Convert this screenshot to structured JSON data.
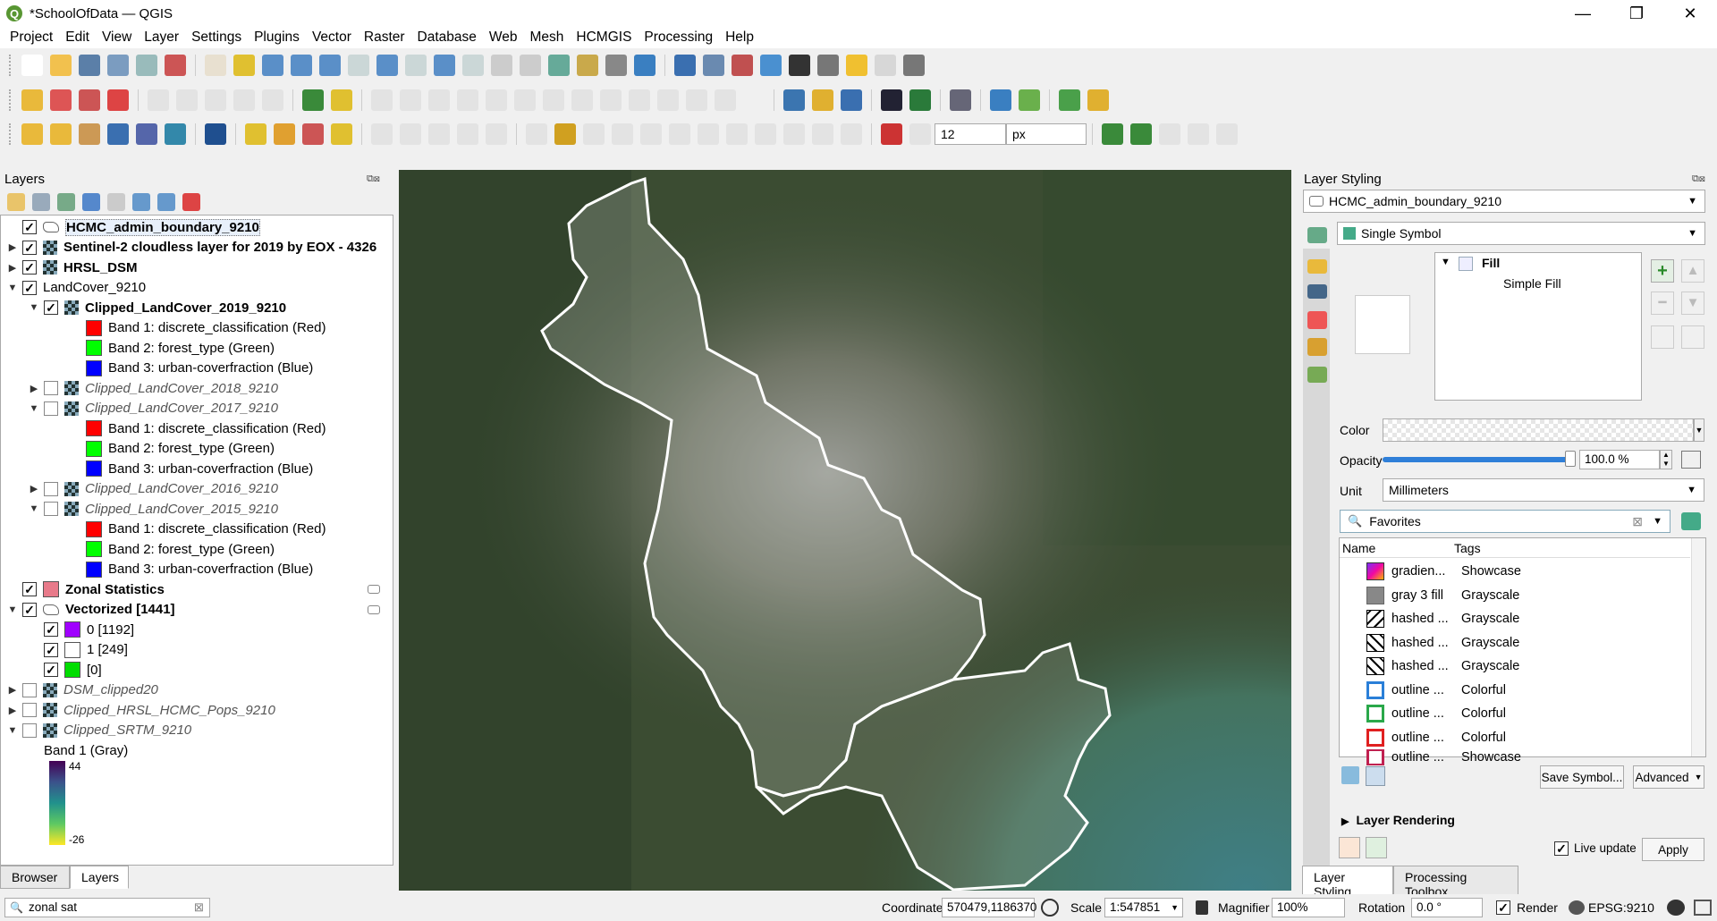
{
  "window": {
    "title": "*SchoolOfData — QGIS",
    "minimize": "—",
    "restore": "❐",
    "close": "✕"
  },
  "menu": [
    "Project",
    "Edit",
    "View",
    "Layer",
    "Settings",
    "Plugins",
    "Vector",
    "Raster",
    "Database",
    "Web",
    "Mesh",
    "HCMGIS",
    "Processing",
    "Help"
  ],
  "toolbar3": {
    "size_value": "12",
    "unit": "px"
  },
  "layers_panel": {
    "title": "Layers",
    "items": [
      {
        "label": "HCMC_admin_boundary_9210",
        "checked": true
      },
      {
        "label": "Sentinel-2 cloudless layer for 2019 by EOX - 4326",
        "checked": true
      },
      {
        "label": "HRSL_DSM",
        "checked": true
      },
      {
        "label": "LandCover_9210",
        "checked": true
      },
      {
        "label": "Clipped_LandCover_2019_9210",
        "checked": true
      },
      {
        "label": "Band 1: discrete_classification (Red)"
      },
      {
        "label": "Band 2: forest_type (Green)"
      },
      {
        "label": "Band 3: urban-coverfraction (Blue)"
      },
      {
        "label": "Clipped_LandCover_2018_9210",
        "checked": false
      },
      {
        "label": "Clipped_LandCover_2017_9210",
        "checked": false
      },
      {
        "label": "Band 1: discrete_classification (Red)"
      },
      {
        "label": "Band 2: forest_type (Green)"
      },
      {
        "label": "Band 3: urban-coverfraction (Blue)"
      },
      {
        "label": "Clipped_LandCover_2016_9210",
        "checked": false
      },
      {
        "label": "Clipped_LandCover_2015_9210",
        "checked": false
      },
      {
        "label": "Band 1: discrete_classification (Red)"
      },
      {
        "label": "Band 2: forest_type (Green)"
      },
      {
        "label": "Band 3: urban-coverfraction (Blue)"
      },
      {
        "label": "Zonal Statistics",
        "checked": true
      },
      {
        "label": "Vectorized [1441]",
        "checked": true
      },
      {
        "label": "0 [1192]",
        "checked": true
      },
      {
        "label": "1 [249]",
        "checked": true
      },
      {
        "label": "[0]",
        "checked": true
      },
      {
        "label": "DSM_clipped20",
        "checked": false
      },
      {
        "label": "Clipped_HRSL_HCMC_Pops_9210",
        "checked": false
      },
      {
        "label": "Clipped_SRTM_9210",
        "checked": false
      },
      {
        "label": "Band 1 (Gray)"
      }
    ],
    "ramp_max": "44",
    "ramp_min": "-26",
    "tab_browser": "Browser",
    "tab_layers": "Layers"
  },
  "search": {
    "value": "zonal sat"
  },
  "styling": {
    "title": "Layer Styling",
    "layer": "HCMC_admin_boundary_9210",
    "renderer": "Single Symbol",
    "symbol_tree": {
      "fill": "Fill",
      "simple_fill": "Simple Fill"
    },
    "color_label": "Color",
    "opacity_label": "Opacity",
    "opacity_value": "100.0 %",
    "opacity_level": 1.0,
    "unit_label": "Unit",
    "unit_value": "Millimeters",
    "favorites": "Favorites",
    "col_name": "Name",
    "col_tags": "Tags",
    "symbols": [
      {
        "name": "gradien...",
        "tag": "Showcase"
      },
      {
        "name": "gray 3 fill",
        "tag": "Grayscale"
      },
      {
        "name": "hashed ...",
        "tag": "Grayscale"
      },
      {
        "name": "hashed ...",
        "tag": "Grayscale"
      },
      {
        "name": "hashed ...",
        "tag": "Grayscale"
      },
      {
        "name": "outline ...",
        "tag": "Colorful"
      },
      {
        "name": "outline ...",
        "tag": "Colorful"
      },
      {
        "name": "outline ...",
        "tag": "Colorful"
      },
      {
        "name": "outline ...",
        "tag": "Showcase"
      }
    ],
    "save_symbol": "Save Symbol...",
    "advanced": "Advanced",
    "layer_rendering": "Layer Rendering",
    "live_update": "Live update",
    "apply": "Apply",
    "tab_styling": "Layer Styling",
    "tab_toolbox": "Processing Toolbox"
  },
  "statusbar": {
    "coordinate_label": "Coordinate",
    "coordinate_value": "570479,1186370",
    "scale_label": "Scale",
    "scale_value": "1:547851",
    "magnifier_label": "Magnifier",
    "magnifier_value": "100%",
    "rotation_label": "Rotation",
    "rotation_value": "0.0 °",
    "render_label": "Render",
    "crs": "EPSG:9210"
  }
}
